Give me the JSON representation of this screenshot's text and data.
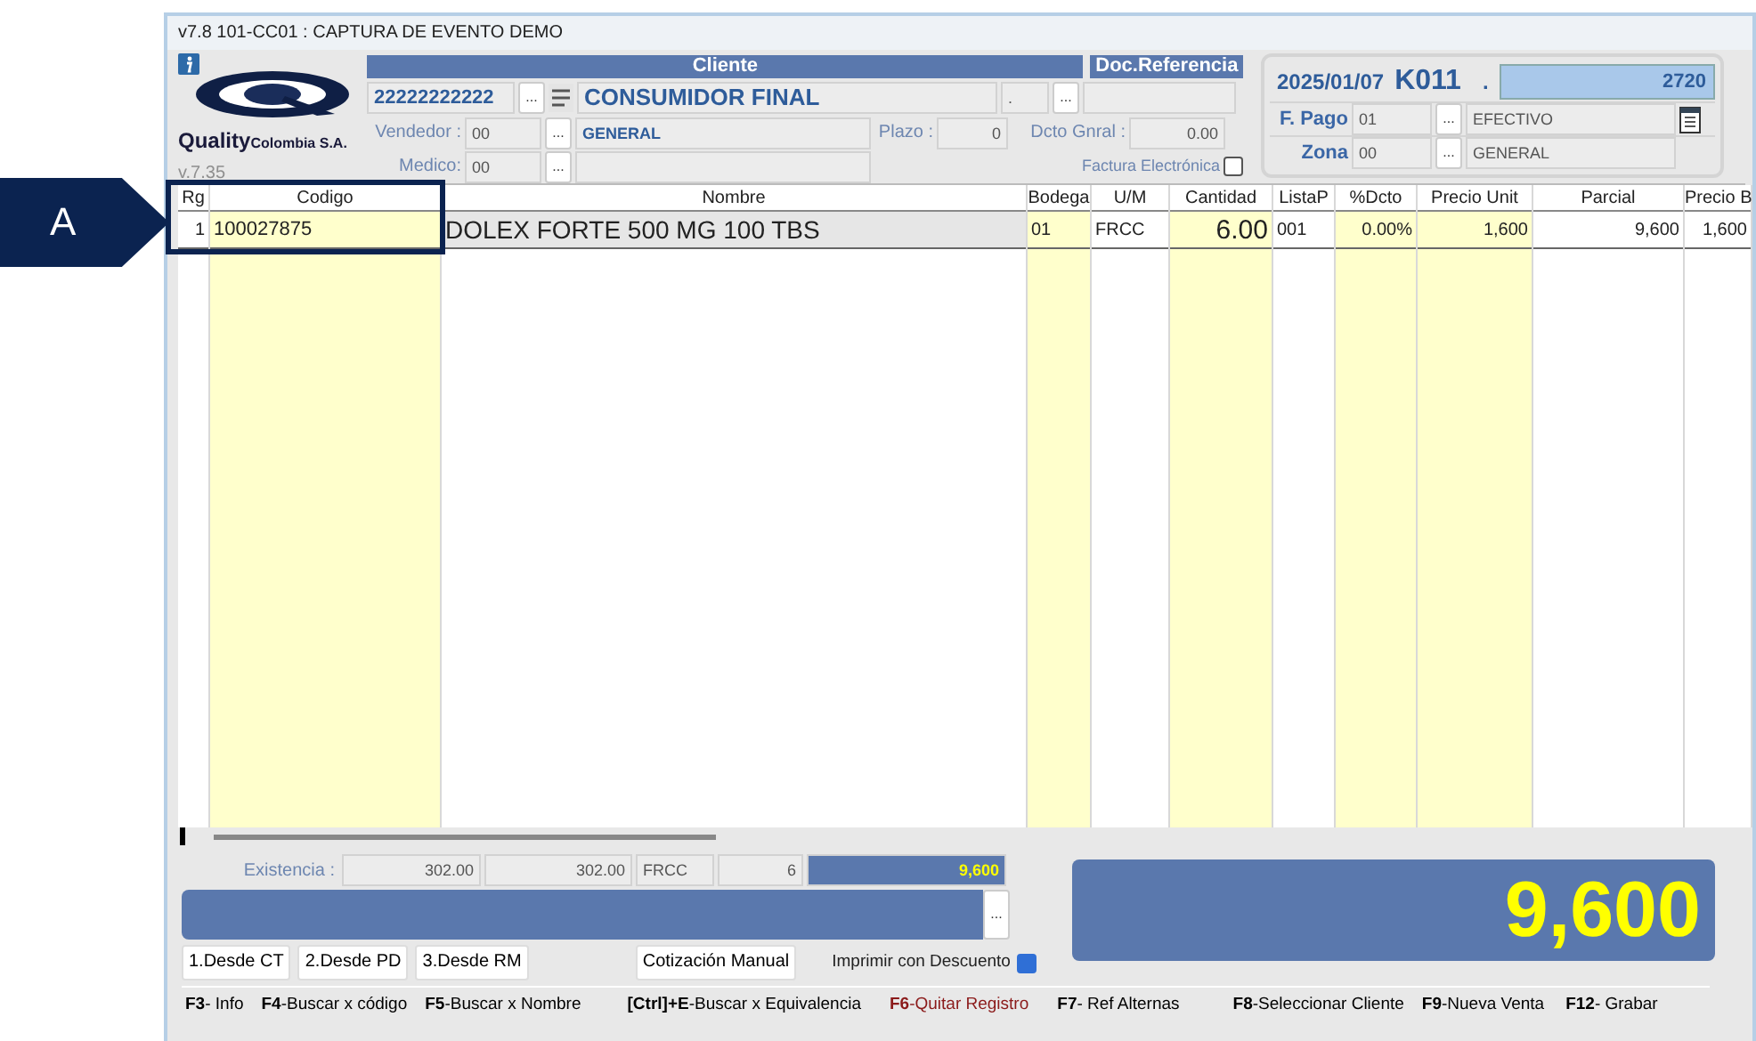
{
  "window": {
    "title": "v7.8 101-CC01 : CAPTURA DE EVENTO DEMO"
  },
  "callout": {
    "label": "A"
  },
  "logo": {
    "brand": "Quality",
    "suffix": "Colombia S.A.",
    "version": "v.7.35"
  },
  "cliente": {
    "header": "Cliente",
    "id": "22222222222",
    "id_button": "...",
    "name": "CONSUMIDOR FINAL",
    "branch": ".",
    "branch_button": "...",
    "vendedor_label": "Vendedor :",
    "vendedor": "00",
    "vendedor_button": "...",
    "vendedor_name": "GENERAL",
    "plazo_label": "Plazo :",
    "plazo": "0",
    "dcto_label": "Dcto Gnral :",
    "dcto": "0.00",
    "medico_label": "Medico:",
    "medico": "00",
    "medico_button": "...",
    "factura_label": "Factura Electrónica",
    "factura_checked": false
  },
  "doc_referencia": {
    "header": "Doc.Referencia"
  },
  "document": {
    "date": "2025/01/07",
    "code": "K011",
    "separator": ".",
    "number": "2720",
    "pago_label": "F. Pago",
    "pago": "01",
    "pago_button": "...",
    "pago_name": "EFECTIVO",
    "zona_label": "Zona",
    "zona": "00",
    "zona_button": "...",
    "zona_name": "GENERAL"
  },
  "table": {
    "columns": [
      {
        "label": "Rg",
        "highlighted": false
      },
      {
        "label": "Codigo",
        "highlighted": true
      },
      {
        "label": "Nombre",
        "highlighted": false
      },
      {
        "label": "Bodega",
        "highlighted": true
      },
      {
        "label": "U/M",
        "highlighted": false
      },
      {
        "label": "Cantidad",
        "highlighted": true
      },
      {
        "label": "ListaP",
        "highlighted": false
      },
      {
        "label": "%Dcto",
        "highlighted": true
      },
      {
        "label": "Precio Unit",
        "highlighted": true
      },
      {
        "label": "Parcial",
        "highlighted": false
      },
      {
        "label": "Precio B",
        "highlighted": false
      }
    ],
    "rows": [
      {
        "cells": [
          "1",
          "100027875",
          "DOLEX FORTE 500 MG 100 TBS",
          "01",
          "FRCC",
          "6.00",
          "001",
          "0.00%",
          "1,600",
          "9,600",
          "1,600"
        ]
      }
    ]
  },
  "existencia": {
    "label": "Existencia :",
    "values": [
      "302.00",
      "302.00",
      "FRCC",
      "6"
    ],
    "total": "9,600"
  },
  "note_bar": {
    "button": "..."
  },
  "buttons": [
    "1.Desde CT",
    "2.Desde PD",
    "3.Desde RM",
    "Cotización Manual"
  ],
  "imprimir": {
    "label": "Imprimir con Descuento",
    "checked": true
  },
  "total": "9,600",
  "shortcuts": [
    {
      "key": "F3",
      "label": "- Info",
      "color": "#000000"
    },
    {
      "key": "F4",
      "label": "-Buscar x código",
      "color": "#000000"
    },
    {
      "key": "F5",
      "label": "-Buscar x Nombre",
      "color": "#000000"
    },
    {
      "key": "[Ctrl]+E",
      "label": "-Buscar x Equivalencia",
      "color": "#000000"
    },
    {
      "key": "F6",
      "label": "-Quitar Registro",
      "color": "#8b1a1a"
    },
    {
      "key": "F7",
      "label": "- Ref Alternas",
      "color": "#000000"
    },
    {
      "key": "F8",
      "label": "-Seleccionar Cliente",
      "color": "#000000"
    },
    {
      "key": "F9",
      "label": "-Nueva Venta",
      "color": "#000000"
    },
    {
      "key": "F12",
      "label": "- Grabar",
      "color": "#000000"
    }
  ]
}
